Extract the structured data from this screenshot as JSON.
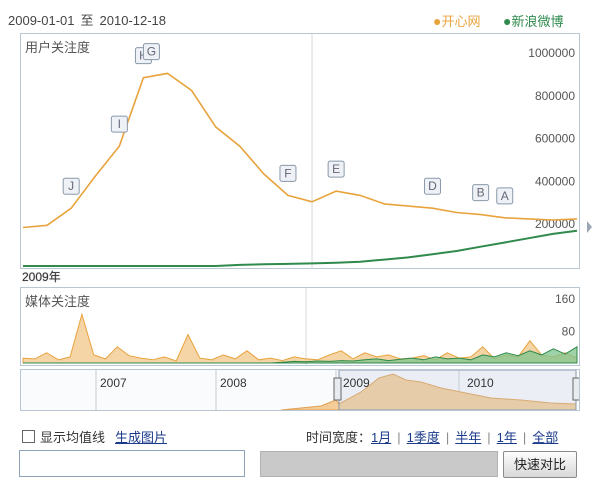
{
  "header": {
    "date_start": "2009-01-01",
    "date_sep": "至",
    "date_end": "2010-12-18",
    "legend": [
      {
        "label": "开心网",
        "color": "#e8a33d"
      },
      {
        "label": "新浪微博",
        "color": "#2f8a4c"
      }
    ]
  },
  "main_chart": {
    "title": "用户关注度"
  },
  "media_chart": {
    "title": "媒体关注度"
  },
  "year_label": "2009年",
  "navigator": {
    "years": [
      "2007",
      "2008",
      "2009",
      "2010"
    ]
  },
  "controls": {
    "show_average_label": "显示均值线",
    "generate_image_label": "生成图片",
    "time_width_label": "时间宽度：",
    "ranges": [
      "1月",
      "1季度",
      "半年",
      "1年",
      "全部"
    ],
    "compare_button_label": "快速对比"
  },
  "chart_data": [
    {
      "type": "line",
      "title": "用户关注度",
      "ylim": [
        0,
        1000000
      ],
      "yticks": [
        200000,
        400000,
        600000,
        800000,
        1000000
      ],
      "x": [
        "2009-01",
        "2009-02",
        "2009-03",
        "2009-04",
        "2009-05",
        "2009-06",
        "2009-07",
        "2009-08",
        "2009-09",
        "2009-10",
        "2009-11",
        "2009-12",
        "2010-01",
        "2010-02",
        "2010-03",
        "2010-04",
        "2010-05",
        "2010-06",
        "2010-07",
        "2010-08",
        "2010-09",
        "2010-10",
        "2010-11",
        "2010-12"
      ],
      "series": [
        {
          "name": "开心网",
          "color": "#e8a33d",
          "values": [
            180000,
            190000,
            270000,
            420000,
            560000,
            880000,
            900000,
            820000,
            650000,
            560000,
            430000,
            330000,
            300000,
            350000,
            330000,
            290000,
            280000,
            270000,
            250000,
            240000,
            225000,
            220000,
            215000,
            220000
          ]
        },
        {
          "name": "新浪微博",
          "color": "#2f8a4c",
          "values": [
            0,
            0,
            0,
            0,
            0,
            0,
            0,
            0,
            0,
            5000,
            8000,
            10000,
            12000,
            15000,
            20000,
            30000,
            40000,
            55000,
            70000,
            90000,
            110000,
            130000,
            150000,
            165000
          ]
        }
      ],
      "annotations": [
        {
          "label": "J",
          "x": "2009-03"
        },
        {
          "label": "I",
          "x": "2009-05"
        },
        {
          "label": "H",
          "x": "2009-06"
        },
        {
          "label": "G",
          "x": "2009-06"
        },
        {
          "label": "F",
          "x": "2009-12"
        },
        {
          "label": "E",
          "x": "2010-02"
        },
        {
          "label": "D",
          "x": "2010-06"
        },
        {
          "label": "B",
          "x": "2010-08"
        },
        {
          "label": "A",
          "x": "2010-09"
        }
      ],
      "grid": false
    },
    {
      "type": "area",
      "title": "媒体关注度",
      "ylim": [
        0,
        160
      ],
      "yticks": [
        80,
        160
      ],
      "series": [
        {
          "name": "开心网",
          "color": "#e8a33d",
          "values": [
            12,
            10,
            25,
            8,
            15,
            120,
            20,
            10,
            40,
            18,
            12,
            8,
            15,
            5,
            70,
            12,
            8,
            20,
            10,
            30,
            8,
            12,
            6,
            15,
            10,
            8,
            20,
            30,
            10,
            25,
            15,
            20,
            10,
            12,
            18,
            8,
            25,
            12,
            15,
            40,
            10,
            20,
            15,
            55,
            20,
            15,
            25,
            12
          ]
        },
        {
          "name": "新浪微博",
          "color": "#2f8a4c",
          "values": [
            0,
            0,
            0,
            0,
            0,
            0,
            0,
            0,
            0,
            0,
            0,
            0,
            0,
            0,
            0,
            0,
            0,
            0,
            0,
            0,
            0,
            0,
            2,
            4,
            3,
            5,
            4,
            6,
            5,
            8,
            10,
            6,
            9,
            12,
            8,
            15,
            10,
            12,
            8,
            20,
            15,
            25,
            18,
            30,
            20,
            35,
            22,
            40
          ]
        }
      ]
    }
  ]
}
